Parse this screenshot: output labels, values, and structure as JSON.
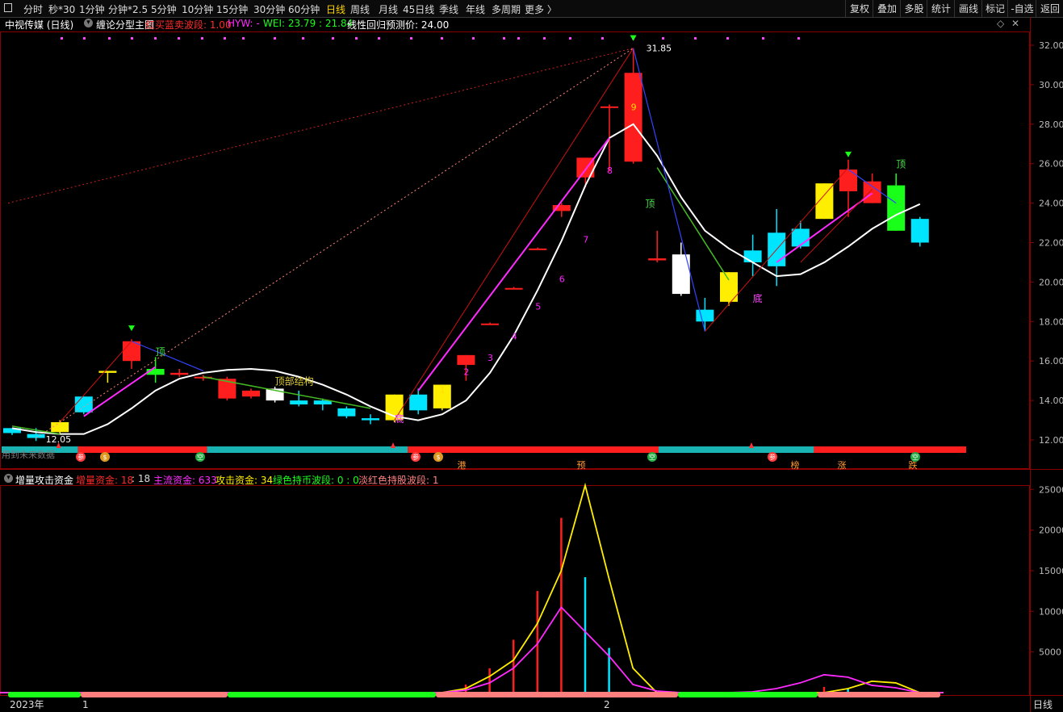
{
  "toolbar": {
    "periods": [
      "分时",
      "秒*30",
      "1分钟",
      "分钟*2.5",
      "5分钟",
      "10分钟",
      "15分钟",
      "30分钟",
      "60分钟",
      "日线",
      "周线",
      "月线",
      "45日线",
      "季线",
      "年线",
      "多周期",
      "更多 〉"
    ],
    "active": "日线",
    "right_buttons": [
      "复权",
      "叠加",
      "多股",
      "统计",
      "画线",
      "标记",
      "-自选",
      "返回"
    ]
  },
  "main_header": {
    "stock": "中视传媒 (日线)",
    "indicator": "缠论分型主图",
    "f1_label": "红买蓝卖波段: 1.00",
    "f2_label": "HYW: -",
    "f3_label": "WEI: 23.79 : 21.84",
    "f4_label": "线性回归预测价: 24.00",
    "diamond": "◇",
    "close": "✕"
  },
  "sub_header": {
    "indicator": "增量攻击资金",
    "f1_label": "增量资金: 18",
    "f1_sep": ": 18",
    "f2_label": "主流资金: 633",
    "f3_label": "攻击资金: 34",
    "f4_label": "绿色持币波段: 0 : 0",
    "f5_label": "淡红色持股波段: 1"
  },
  "colors": {
    "up": "#ff1e1e",
    "down": "#00e5ff",
    "yellow": "#ffee00",
    "magenta": "#ff2aff",
    "green": "#19ff19",
    "white": "#ffffff",
    "blue": "#2233ff"
  },
  "chart_data": [
    {
      "type": "candlestick",
      "title": "缠论分型主图",
      "ylim": [
        11.2,
        32.9
      ],
      "y_ticks": [
        "12.00",
        "14.00",
        "16.00",
        "18.00",
        "20.00",
        "22.00",
        "24.00",
        "26.00",
        "28.00",
        "30.00",
        "32.00"
      ],
      "candles": [
        {
          "o": 12.35,
          "h": 12.6,
          "l": 12.25,
          "c": 12.6,
          "color": "cyan"
        },
        {
          "o": 12.1,
          "h": 12.6,
          "l": 11.95,
          "c": 12.3,
          "color": "cyan"
        },
        {
          "o": 12.4,
          "h": 13.0,
          "l": 12.3,
          "c": 12.9,
          "color": "yellow"
        },
        {
          "o": 13.4,
          "h": 14.2,
          "l": 13.3,
          "c": 14.2,
          "color": "cyan"
        },
        {
          "o": 15.4,
          "h": 15.5,
          "l": 14.9,
          "c": 15.5,
          "color": "yellow"
        },
        {
          "o": 16.0,
          "h": 17.1,
          "l": 15.6,
          "c": 17.0,
          "color": "red"
        },
        {
          "o": 15.3,
          "h": 16.2,
          "l": 14.9,
          "c": 15.6,
          "color": "green"
        },
        {
          "o": 15.4,
          "h": 15.6,
          "l": 15.2,
          "c": 15.3,
          "color": "red"
        },
        {
          "o": 15.2,
          "h": 15.3,
          "l": 15.0,
          "c": 15.2,
          "color": "red"
        },
        {
          "o": 14.1,
          "h": 15.2,
          "l": 14.0,
          "c": 15.1,
          "color": "red"
        },
        {
          "o": 14.2,
          "h": 14.6,
          "l": 14.1,
          "c": 14.5,
          "color": "red"
        },
        {
          "o": 14.0,
          "h": 14.7,
          "l": 13.9,
          "c": 14.6,
          "color": "white"
        },
        {
          "o": 13.8,
          "h": 14.5,
          "l": 13.7,
          "c": 14.0,
          "color": "cyan"
        },
        {
          "o": 13.8,
          "h": 14.1,
          "l": 13.5,
          "c": 14.0,
          "color": "cyan"
        },
        {
          "o": 13.2,
          "h": 13.7,
          "l": 13.1,
          "c": 13.6,
          "color": "cyan"
        },
        {
          "o": 13.0,
          "h": 13.3,
          "l": 12.8,
          "c": 13.1,
          "color": "cyan"
        },
        {
          "o": 13.0,
          "h": 14.3,
          "l": 12.9,
          "c": 14.3,
          "color": "yellow"
        },
        {
          "o": 13.5,
          "h": 14.6,
          "l": 13.3,
          "c": 14.3,
          "color": "cyan"
        },
        {
          "o": 13.6,
          "h": 14.8,
          "l": 13.5,
          "c": 14.8,
          "color": "yellow"
        },
        {
          "o": 15.8,
          "h": 16.3,
          "l": 15.0,
          "c": 16.3,
          "color": "red"
        },
        {
          "o": 17.9,
          "h": 17.95,
          "l": 17.85,
          "c": 17.9,
          "color": "red"
        },
        {
          "o": 19.7,
          "h": 19.75,
          "l": 19.65,
          "c": 19.7,
          "color": "red"
        },
        {
          "o": 21.7,
          "h": 21.75,
          "l": 21.65,
          "c": 21.7,
          "color": "red"
        },
        {
          "o": 23.6,
          "h": 24.0,
          "l": 23.3,
          "c": 23.9,
          "color": "red"
        },
        {
          "o": 25.3,
          "h": 26.3,
          "l": 24.8,
          "c": 26.3,
          "color": "red"
        },
        {
          "o": 28.9,
          "h": 29.0,
          "l": 25.6,
          "c": 28.9,
          "color": "red"
        },
        {
          "o": 26.1,
          "h": 31.85,
          "l": 26.0,
          "c": 30.6,
          "color": "red"
        },
        {
          "o": 21.1,
          "h": 22.6,
          "l": 21.0,
          "c": 21.2,
          "color": "red"
        },
        {
          "o": 19.4,
          "h": 22.0,
          "l": 19.3,
          "c": 21.4,
          "color": "white"
        },
        {
          "o": 18.0,
          "h": 19.2,
          "l": 17.5,
          "c": 18.6,
          "color": "cyan"
        },
        {
          "o": 19.0,
          "h": 20.5,
          "l": 18.8,
          "c": 20.5,
          "color": "yellow"
        },
        {
          "o": 21.0,
          "h": 22.4,
          "l": 20.3,
          "c": 21.6,
          "color": "cyan"
        },
        {
          "o": 20.8,
          "h": 23.7,
          "l": 19.8,
          "c": 22.5,
          "color": "cyan"
        },
        {
          "o": 21.8,
          "h": 23.1,
          "l": 21.7,
          "c": 22.7,
          "color": "cyan"
        },
        {
          "o": 23.2,
          "h": 25.0,
          "l": 23.2,
          "c": 25.0,
          "color": "yellow"
        },
        {
          "o": 24.6,
          "h": 26.2,
          "l": 23.3,
          "c": 25.7,
          "color": "red"
        },
        {
          "o": 24.0,
          "h": 25.5,
          "l": 24.0,
          "c": 25.1,
          "color": "red"
        },
        {
          "o": 22.6,
          "h": 25.5,
          "l": 22.6,
          "c": 24.9,
          "color": "green"
        },
        {
          "o": 22.0,
          "h": 23.3,
          "l": 21.8,
          "c": 23.2,
          "color": "cyan"
        }
      ],
      "white_ma": [
        12.6,
        12.4,
        12.3,
        12.3,
        12.8,
        13.6,
        14.5,
        15.1,
        15.4,
        15.55,
        15.6,
        15.5,
        15.2,
        14.8,
        14.3,
        13.7,
        13.2,
        13.0,
        13.3,
        14.0,
        15.4,
        17.3,
        19.6,
        22.1,
        24.9,
        27.3,
        28.0,
        26.4,
        24.3,
        22.6,
        21.7,
        21.0,
        20.3,
        20.4,
        21.0,
        21.8,
        22.7,
        23.4,
        23.95
      ],
      "numbers": [
        "1",
        "2",
        "3",
        "4",
        "5",
        "6",
        "7",
        "8",
        "9"
      ],
      "annotations": [
        "顶",
        "顶部结构",
        "底",
        "顶",
        "底",
        "顶"
      ],
      "price_labels": [
        "31.85",
        "12.05"
      ],
      "band_icons": [
        "参",
        "$",
        "空",
        "参",
        "$",
        "港",
        "预",
        "空",
        "参",
        "榜",
        "涨",
        "跌",
        "空"
      ],
      "band_note": "用到未来数据"
    },
    {
      "type": "bar+line",
      "title": "增量攻击资金",
      "ylim": [
        0,
        26500
      ],
      "y_ticks": [
        "5000",
        "10000",
        "15000",
        "20000",
        "25000"
      ],
      "yellow_line": [
        0,
        0,
        0,
        0,
        0,
        0,
        0,
        0,
        0,
        0,
        0,
        0,
        0,
        0,
        0,
        0,
        0,
        0,
        0,
        0,
        500,
        2000,
        4000,
        8500,
        15000,
        25500,
        14000,
        3000,
        0,
        0,
        0,
        0,
        0,
        0,
        0,
        0,
        500,
        1400,
        1200,
        0,
        0
      ],
      "magenta_line": [
        0,
        0,
        0,
        0,
        0,
        0,
        0,
        0,
        0,
        0,
        0,
        0,
        0,
        0,
        0,
        0,
        0,
        0,
        0,
        0,
        300,
        1200,
        3000,
        6000,
        10500,
        7500,
        4500,
        1000,
        200,
        0,
        0,
        0,
        100,
        500,
        1200,
        2200,
        1900,
        900,
        600,
        0,
        0
      ],
      "red_bars": [
        0,
        0,
        0,
        0,
        0,
        0,
        0,
        0,
        0,
        0,
        0,
        0,
        0,
        0,
        0,
        0,
        0,
        0,
        0,
        0,
        1000,
        3000,
        6500,
        12500,
        21500,
        0,
        0,
        0,
        0,
        0,
        0,
        0,
        0,
        0,
        0,
        700,
        0,
        0,
        0,
        0,
        0
      ],
      "cyan_bars": [
        0,
        0,
        0,
        0,
        0,
        0,
        0,
        0,
        0,
        0,
        0,
        0,
        0,
        0,
        0,
        0,
        0,
        0,
        0,
        0,
        0,
        0,
        0,
        0,
        0,
        14200,
        5500,
        0,
        0,
        0,
        0,
        0,
        0,
        0,
        0,
        0,
        500,
        0,
        0,
        0,
        0
      ],
      "x_labels": [
        "2023年",
        "1",
        "2"
      ],
      "bottom_right_label": "日线"
    }
  ]
}
